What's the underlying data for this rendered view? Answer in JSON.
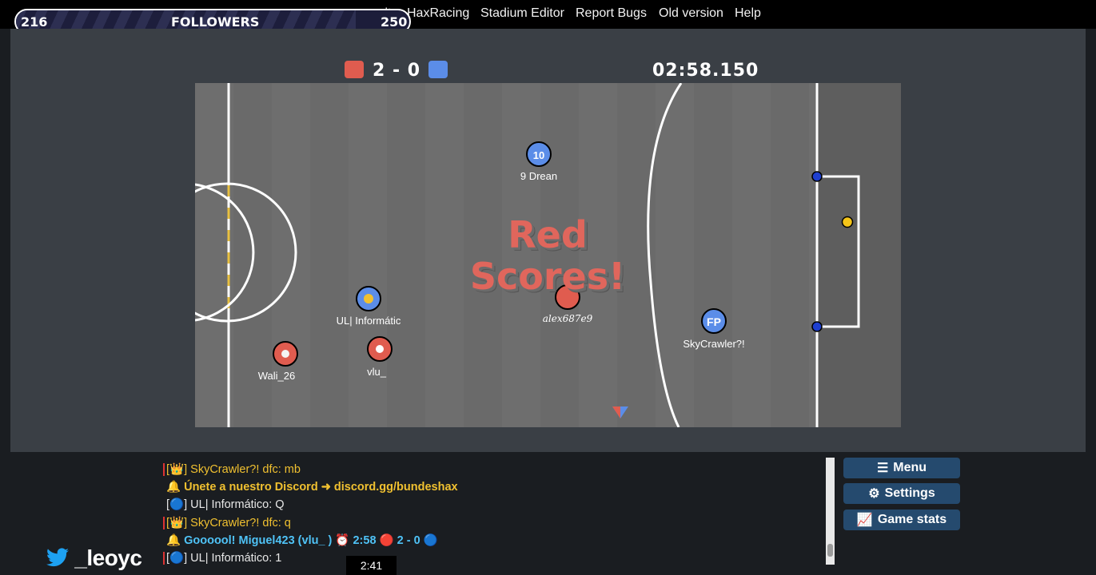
{
  "nav": {
    "items": [
      "mmunity",
      "HaxRacing",
      "Stadium Editor",
      "Report Bugs",
      "Old version",
      "Help"
    ]
  },
  "followers": {
    "current": "216",
    "label": "FOLLOWERS",
    "goal": "250",
    "progress": 0.864
  },
  "scoreboard": {
    "score": "2 - 0",
    "time": "02:58.150",
    "red_color": "#e05c4f",
    "blue_color": "#5b8de8"
  },
  "banner": {
    "line1": "Red",
    "line2": "Scores!"
  },
  "players": [
    {
      "name": "9 Drean",
      "team": "blue",
      "avatar": "10"
    },
    {
      "name": "UL| Informátic",
      "team": "blue",
      "avatar": "🐥"
    },
    {
      "name": "alex687e9",
      "team": "red",
      "avatar": ""
    },
    {
      "name": "SkyCrawler?!",
      "team": "blue",
      "avatar": "FP"
    },
    {
      "name": "Wali_26",
      "team": "red",
      "avatar": "🐧",
      "badge": "🐧"
    },
    {
      "name": "vlu_",
      "team": "red",
      "avatar": "✿"
    }
  ],
  "chat": [
    {
      "prefix": "[👑]",
      "text": "SkyCrawler?! dfc: mb",
      "style": "gold"
    },
    {
      "prefix": "🔔",
      "text": "Únete a nuestro Discord ➜ discord.gg/bundeshax",
      "style": "disc"
    },
    {
      "prefix": "[🔵]",
      "text": "UL| Informático: Q",
      "style": "plain"
    },
    {
      "prefix": "[👑]",
      "text": "SkyCrawler?! dfc: q",
      "style": "gold"
    },
    {
      "prefix": "🔔",
      "text": "Goooool! Miguel423 (vlu_ ) ⏰ 2:58 🔴 2 - 0 🔵",
      "style": "goal"
    },
    {
      "prefix": "[🔵]",
      "text": "UL| Informático: 1",
      "style": "plain"
    }
  ],
  "menu": {
    "menu_label": "Menu",
    "settings_label": "Settings",
    "stats_label": "Game stats"
  },
  "twitter": {
    "handle": "_leoyc"
  },
  "video": {
    "time": "2:41"
  },
  "colors": {
    "pitch": "#6d6d6d",
    "blue_disc": "#2a57e0",
    "ball": "#f5c518"
  }
}
